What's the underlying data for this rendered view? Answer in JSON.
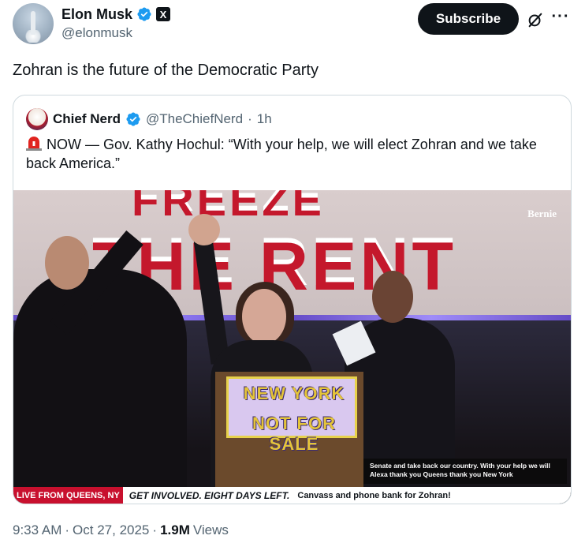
{
  "author": {
    "display_name": "Elon Musk",
    "handle": "@elonmusk",
    "verified_icon": "verified-badge-icon",
    "affiliate_badge": "X"
  },
  "actions": {
    "subscribe_label": "Subscribe",
    "grok_icon": "grok-icon",
    "more_icon": "more-icon",
    "more_glyph": "···"
  },
  "tweet": {
    "text": "Zohran is the future of the Democratic Party"
  },
  "quoted": {
    "display_name": "Chief Nerd",
    "handle": "@TheChiefNerd",
    "separator": "·",
    "time": "1h",
    "text": "NOW — Gov. Kathy Hochul: “With your help, we will elect Zohran and we take back America.”",
    "media": {
      "watermark": "Bernie",
      "banner_line1": "FREEZE",
      "banner_line2": "THE RENT",
      "podium_line1": "NEW YORK",
      "podium_line2": "NOT FOR SALE",
      "caption": "Senate and take back our country. With your help we will Alexa thank you Queens thank you New York",
      "ticker_live": "LIVE FROM QUEENS, NY",
      "ticker_headline": "GET INVOLVED. EIGHT DAYS LEFT.",
      "ticker_sub": "Canvass and phone bank for Zohran!"
    }
  },
  "footer": {
    "time": "9:33 AM",
    "dot1": "·",
    "date": "Oct 27, 2025",
    "dot2": "·",
    "views_count": "1.9M",
    "views_label": "Views"
  },
  "colors": {
    "verified": "#1d9bf0",
    "text": "#0f1419",
    "muted": "#536471",
    "border": "#cfd9de",
    "ticker_red": "#c8102e"
  }
}
